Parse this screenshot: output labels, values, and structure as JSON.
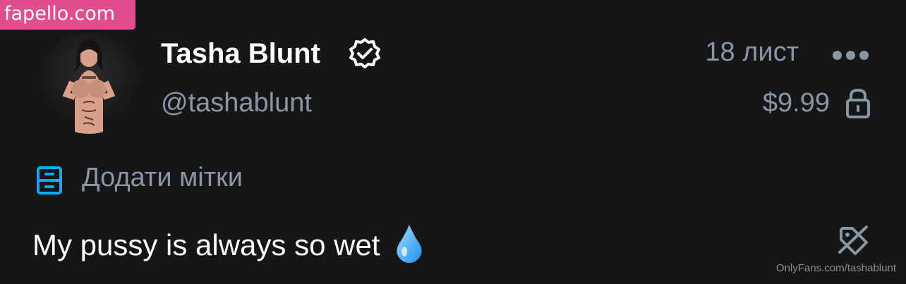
{
  "watermark": {
    "text": "fapello.com"
  },
  "post": {
    "author_name": "Tasha Blunt",
    "author_handle": "@tashablunt",
    "date": "18 лист",
    "price": "$9.99",
    "add_tags_label": "Додати мітки",
    "text": "My pussy is always so wet"
  },
  "footer": {
    "source_watermark": "OnlyFans.com/tashablunt"
  },
  "icons": {
    "verified": "verified-badge-icon",
    "more": "more-horizontal-icon",
    "lock": "lock-icon",
    "tags": "tag-list-icon",
    "no_tag": "tag-off-icon",
    "drop": "water-drop-emoji"
  },
  "colors": {
    "background": "#151618",
    "muted_text": "#8a96a3",
    "accent_blue": "#00aff0",
    "watermark_pink": "#e24d8e"
  }
}
